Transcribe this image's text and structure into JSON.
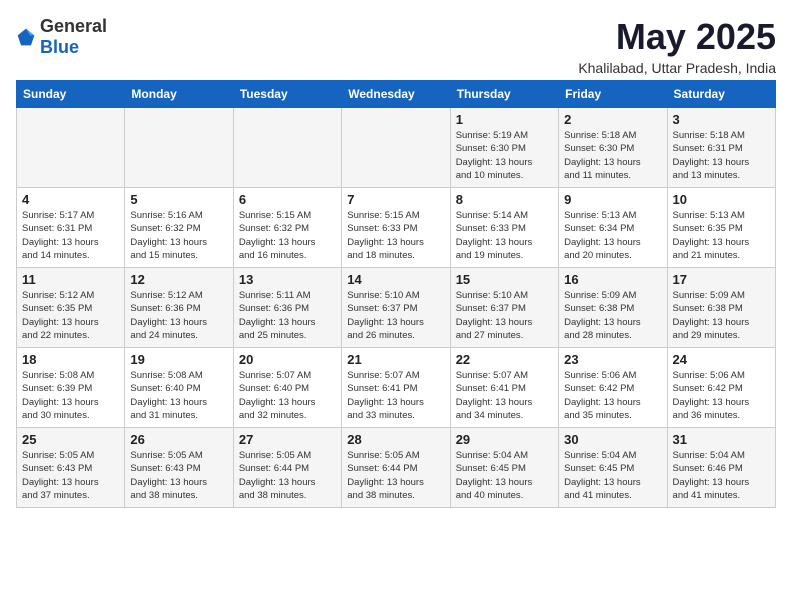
{
  "header": {
    "logo_general": "General",
    "logo_blue": "Blue",
    "title": "May 2025",
    "subtitle": "Khalilabad, Uttar Pradesh, India"
  },
  "weekdays": [
    "Sunday",
    "Monday",
    "Tuesday",
    "Wednesday",
    "Thursday",
    "Friday",
    "Saturday"
  ],
  "weeks": [
    [
      {
        "day": "",
        "info": ""
      },
      {
        "day": "",
        "info": ""
      },
      {
        "day": "",
        "info": ""
      },
      {
        "day": "",
        "info": ""
      },
      {
        "day": "1",
        "info": "Sunrise: 5:19 AM\nSunset: 6:30 PM\nDaylight: 13 hours\nand 10 minutes."
      },
      {
        "day": "2",
        "info": "Sunrise: 5:18 AM\nSunset: 6:30 PM\nDaylight: 13 hours\nand 11 minutes."
      },
      {
        "day": "3",
        "info": "Sunrise: 5:18 AM\nSunset: 6:31 PM\nDaylight: 13 hours\nand 13 minutes."
      }
    ],
    [
      {
        "day": "4",
        "info": "Sunrise: 5:17 AM\nSunset: 6:31 PM\nDaylight: 13 hours\nand 14 minutes."
      },
      {
        "day": "5",
        "info": "Sunrise: 5:16 AM\nSunset: 6:32 PM\nDaylight: 13 hours\nand 15 minutes."
      },
      {
        "day": "6",
        "info": "Sunrise: 5:15 AM\nSunset: 6:32 PM\nDaylight: 13 hours\nand 16 minutes."
      },
      {
        "day": "7",
        "info": "Sunrise: 5:15 AM\nSunset: 6:33 PM\nDaylight: 13 hours\nand 18 minutes."
      },
      {
        "day": "8",
        "info": "Sunrise: 5:14 AM\nSunset: 6:33 PM\nDaylight: 13 hours\nand 19 minutes."
      },
      {
        "day": "9",
        "info": "Sunrise: 5:13 AM\nSunset: 6:34 PM\nDaylight: 13 hours\nand 20 minutes."
      },
      {
        "day": "10",
        "info": "Sunrise: 5:13 AM\nSunset: 6:35 PM\nDaylight: 13 hours\nand 21 minutes."
      }
    ],
    [
      {
        "day": "11",
        "info": "Sunrise: 5:12 AM\nSunset: 6:35 PM\nDaylight: 13 hours\nand 22 minutes."
      },
      {
        "day": "12",
        "info": "Sunrise: 5:12 AM\nSunset: 6:36 PM\nDaylight: 13 hours\nand 24 minutes."
      },
      {
        "day": "13",
        "info": "Sunrise: 5:11 AM\nSunset: 6:36 PM\nDaylight: 13 hours\nand 25 minutes."
      },
      {
        "day": "14",
        "info": "Sunrise: 5:10 AM\nSunset: 6:37 PM\nDaylight: 13 hours\nand 26 minutes."
      },
      {
        "day": "15",
        "info": "Sunrise: 5:10 AM\nSunset: 6:37 PM\nDaylight: 13 hours\nand 27 minutes."
      },
      {
        "day": "16",
        "info": "Sunrise: 5:09 AM\nSunset: 6:38 PM\nDaylight: 13 hours\nand 28 minutes."
      },
      {
        "day": "17",
        "info": "Sunrise: 5:09 AM\nSunset: 6:38 PM\nDaylight: 13 hours\nand 29 minutes."
      }
    ],
    [
      {
        "day": "18",
        "info": "Sunrise: 5:08 AM\nSunset: 6:39 PM\nDaylight: 13 hours\nand 30 minutes."
      },
      {
        "day": "19",
        "info": "Sunrise: 5:08 AM\nSunset: 6:40 PM\nDaylight: 13 hours\nand 31 minutes."
      },
      {
        "day": "20",
        "info": "Sunrise: 5:07 AM\nSunset: 6:40 PM\nDaylight: 13 hours\nand 32 minutes."
      },
      {
        "day": "21",
        "info": "Sunrise: 5:07 AM\nSunset: 6:41 PM\nDaylight: 13 hours\nand 33 minutes."
      },
      {
        "day": "22",
        "info": "Sunrise: 5:07 AM\nSunset: 6:41 PM\nDaylight: 13 hours\nand 34 minutes."
      },
      {
        "day": "23",
        "info": "Sunrise: 5:06 AM\nSunset: 6:42 PM\nDaylight: 13 hours\nand 35 minutes."
      },
      {
        "day": "24",
        "info": "Sunrise: 5:06 AM\nSunset: 6:42 PM\nDaylight: 13 hours\nand 36 minutes."
      }
    ],
    [
      {
        "day": "25",
        "info": "Sunrise: 5:05 AM\nSunset: 6:43 PM\nDaylight: 13 hours\nand 37 minutes."
      },
      {
        "day": "26",
        "info": "Sunrise: 5:05 AM\nSunset: 6:43 PM\nDaylight: 13 hours\nand 38 minutes."
      },
      {
        "day": "27",
        "info": "Sunrise: 5:05 AM\nSunset: 6:44 PM\nDaylight: 13 hours\nand 38 minutes."
      },
      {
        "day": "28",
        "info": "Sunrise: 5:05 AM\nSunset: 6:44 PM\nDaylight: 13 hours\nand 38 minutes."
      },
      {
        "day": "29",
        "info": "Sunrise: 5:04 AM\nSunset: 6:45 PM\nDaylight: 13 hours\nand 40 minutes."
      },
      {
        "day": "30",
        "info": "Sunrise: 5:04 AM\nSunset: 6:45 PM\nDaylight: 13 hours\nand 41 minutes."
      },
      {
        "day": "31",
        "info": "Sunrise: 5:04 AM\nSunset: 6:46 PM\nDaylight: 13 hours\nand 41 minutes."
      }
    ]
  ]
}
